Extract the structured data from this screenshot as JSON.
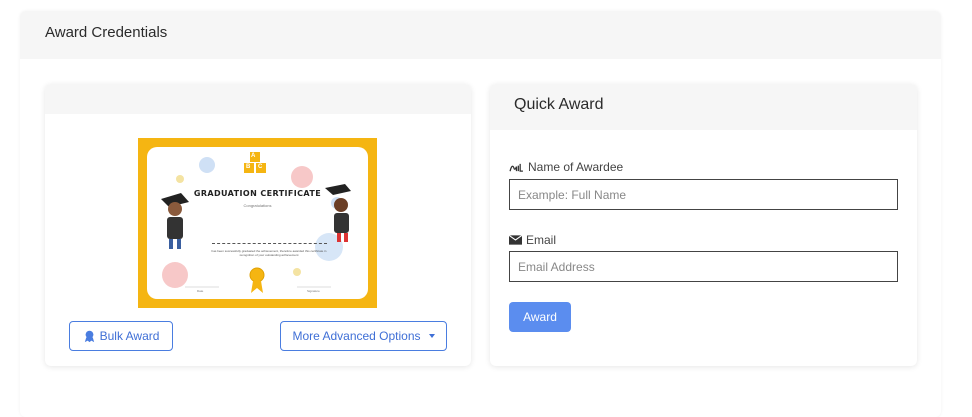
{
  "page": {
    "title": "Award Credentials"
  },
  "certificate": {
    "title": "GRADUATION CERTIFICATE",
    "subtitle": "Congratulations",
    "body": "has been successfully graduated the achievement, therefore awarded this certificate in recognition of your outstanding achievement",
    "date_label": "Date",
    "signature_label": "Signature",
    "blocks": [
      "A",
      "B",
      "C"
    ],
    "border_color": "#f5b512"
  },
  "left_card": {
    "bulk_award_label": "Bulk Award",
    "more_options_label": "More Advanced Options",
    "bulk_icon": "award-ribbon-icon",
    "dropdown_icon": "caret-down-icon"
  },
  "quick_award": {
    "title": "Quick Award",
    "name_label": "Name of Awardee",
    "name_placeholder": "Example: Full Name",
    "name_value": "",
    "name_icon": "signature-icon",
    "email_label": "Email",
    "email_placeholder": "Email Address",
    "email_value": "",
    "email_icon": "envelope-icon",
    "award_button_label": "Award",
    "accent_color": "#5b8def"
  }
}
